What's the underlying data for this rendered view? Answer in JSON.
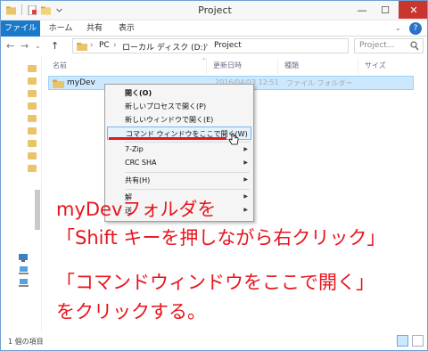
{
  "window": {
    "title": "Project",
    "min": "—",
    "max": "☐",
    "close": "✕"
  },
  "ribbon": {
    "tabs": [
      "ファイル",
      "ホーム",
      "共有",
      "表示"
    ],
    "help": "?",
    "collapse": "⌄"
  },
  "nav": {
    "back": "←",
    "forward": "→",
    "recent": "⌄",
    "up": "↑",
    "breadcrumbs": [
      "PC",
      "ローカル ディスク (D:)",
      "Project"
    ],
    "crumb_sep": "›",
    "dropdown": "⌄",
    "refresh": "↻",
    "search_placeholder": "Project..."
  },
  "columns": {
    "name": "名前",
    "date": "更新日時",
    "type": "種類",
    "size": "サイズ",
    "sort": "^"
  },
  "files": [
    {
      "name": "myDev",
      "date": "2016/04/03 12:51",
      "type": "ファイル フォルダー"
    }
  ],
  "context_menu": {
    "items": [
      {
        "label": "開く(O)",
        "bold": true
      },
      {
        "label": "新しいプロセスで開く(P)"
      },
      {
        "label": "新しいウィンドウで開く(E)"
      },
      {
        "label": "コマンド ウィンドウをここで開く(W)",
        "highlighted": true
      },
      {
        "label": "7-Zip",
        "submenu": true
      },
      {
        "label": "CRC SHA",
        "submenu": true
      },
      {
        "label": "共有(H)",
        "submenu": true
      },
      {
        "label": "解",
        "submenu": true
      },
      {
        "label": "送",
        "submenu": true
      }
    ],
    "submenu_arrow": "▶"
  },
  "annotation": {
    "line1": "myDevフォルダを",
    "line2": "「Shift キーを押しながら右クリック」",
    "line3": "「コマンドウィンドウをここで開く」",
    "line4": "をクリックする。",
    "color": "#e8141c"
  },
  "status": {
    "count": "1 個の項目"
  },
  "colors": {
    "accent": "#1979ca",
    "selection": "#cce8ff",
    "close": "#c7372f"
  }
}
